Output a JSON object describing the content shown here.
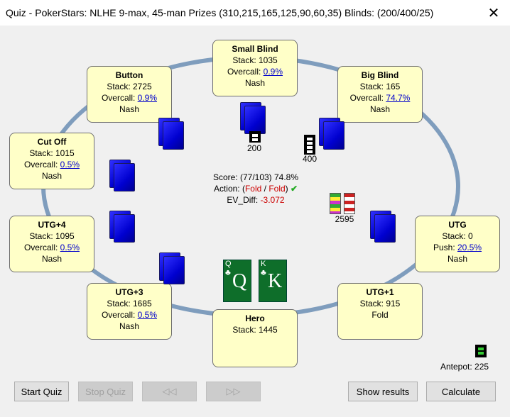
{
  "window": {
    "title": "Quiz - PokerStars: NLHE 9-max, 45-man Prizes (310,215,165,125,90,60,35) Blinds: (200/400/25)",
    "close_icon": "✕"
  },
  "seats": {
    "small_blind": {
      "name": "Small Blind",
      "stack": "Stack: 1035",
      "line3_label": "Overcall: ",
      "line3_value": "0.9%",
      "action": "Nash"
    },
    "big_blind": {
      "name": "Big Blind",
      "stack": "Stack: 165",
      "line3_label": "Overcall: ",
      "line3_value": "74.7%",
      "action": "Nash"
    },
    "button": {
      "name": "Button",
      "stack": "Stack: 2725",
      "line3_label": "Overcall: ",
      "line3_value": "0.9%",
      "action": "Nash"
    },
    "cut_off": {
      "name": "Cut Off",
      "stack": "Stack: 1015",
      "line3_label": "Overcall: ",
      "line3_value": "0.5%",
      "action": "Nash"
    },
    "utg4": {
      "name": "UTG+4",
      "stack": "Stack: 1095",
      "line3_label": "Overcall: ",
      "line3_value": "0.5%",
      "action": "Nash"
    },
    "utg3": {
      "name": "UTG+3",
      "stack": "Stack: 1685",
      "line3_label": "Overcall: ",
      "line3_value": "0.5%",
      "action": "Nash"
    },
    "utg": {
      "name": "UTG",
      "stack": "Stack: 0",
      "line3_label": "Push: ",
      "line3_value": "20.5%",
      "action": "Nash"
    },
    "utg1": {
      "name": "UTG+1",
      "stack": "Stack: 915",
      "action": "Fold"
    },
    "hero": {
      "name": "Hero",
      "stack": "Stack: 1445"
    }
  },
  "bets": {
    "small_blind": "200",
    "big_blind": "400",
    "utg": "2595"
  },
  "info": {
    "score": "Score: (77/103) 74.8%",
    "action_label": "Action: (",
    "action_1": "Fold",
    "action_sep": " / ",
    "action_2": "Fold",
    "action_close": ")",
    "check_icon": "✔",
    "ev_label": "EV_Diff: ",
    "ev_value": "-3.072"
  },
  "hero_cards": [
    {
      "rank": "Q",
      "suit": "♣"
    },
    {
      "rank": "K",
      "suit": "♣"
    }
  ],
  "antepot": "Antepot: 225",
  "buttons": {
    "start_quiz": "Start Quiz",
    "stop_quiz": "Stop Quiz",
    "prev": "◁◁",
    "next": "▷▷",
    "show_results": "Show results",
    "calculate": "Calculate"
  },
  "colors": {
    "seat_bg": "#ffffc8",
    "table_ring": "#7f9dbd",
    "card_green": "#0e6e2a",
    "card_back_blue": "#0000d0"
  }
}
